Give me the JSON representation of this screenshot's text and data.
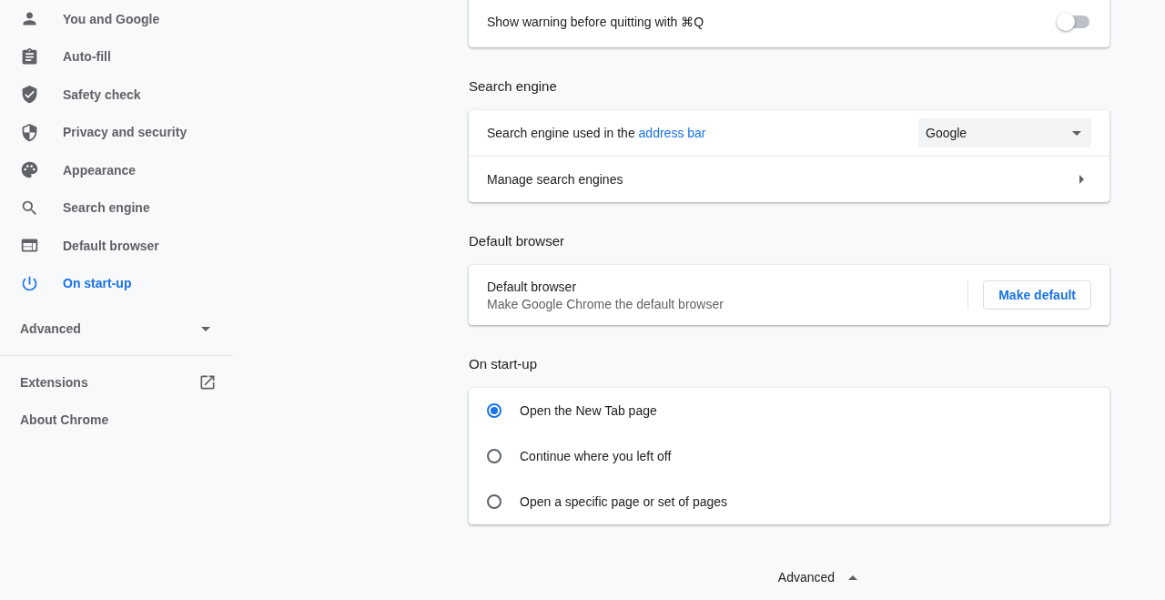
{
  "sidebar": {
    "items": [
      {
        "label": "You and Google",
        "selected": false
      },
      {
        "label": "Auto-fill",
        "selected": false
      },
      {
        "label": "Safety check",
        "selected": false
      },
      {
        "label": "Privacy and security",
        "selected": false
      },
      {
        "label": "Appearance",
        "selected": false
      },
      {
        "label": "Search engine",
        "selected": false
      },
      {
        "label": "Default browser",
        "selected": false
      },
      {
        "label": "On start-up",
        "selected": true
      }
    ],
    "advanced": {
      "label": "Advanced",
      "expanded": false
    },
    "links": [
      {
        "label": "Extensions",
        "external": true
      },
      {
        "label": "About Chrome",
        "external": false
      }
    ]
  },
  "quit_warning": {
    "label": "Show warning before quitting with ⌘Q",
    "on": false
  },
  "search_engine": {
    "heading": "Search engine",
    "label": "Search engine used in the",
    "link": "address bar",
    "dropdown": "Google",
    "manage": "Manage search engines"
  },
  "default_browser": {
    "heading": "Default browser",
    "title": "Default browser",
    "subtitle": "Make Google Chrome the default browser",
    "button": "Make default"
  },
  "startup": {
    "heading": "On start-up",
    "options": [
      {
        "label": "Open the New Tab page",
        "selected": true
      },
      {
        "label": "Continue where you left off",
        "selected": false
      },
      {
        "label": "Open a specific page or set of pages",
        "selected": false
      }
    ]
  },
  "advanced_toggle": {
    "label": "Advanced",
    "expanded": true
  }
}
